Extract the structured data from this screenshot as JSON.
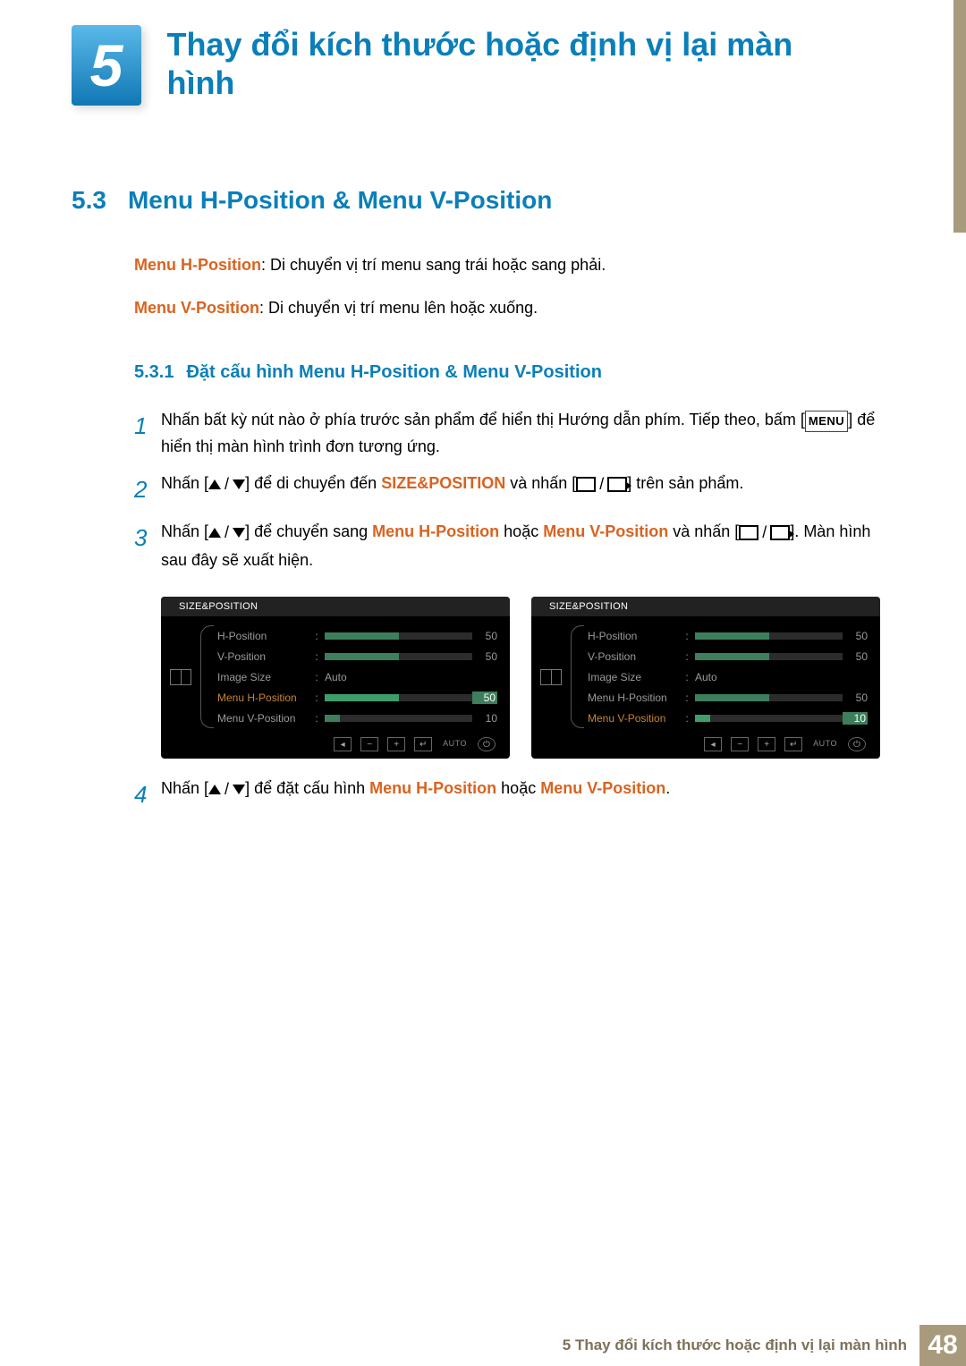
{
  "chapter": {
    "number": "5",
    "title": "Thay đổi kích thước hoặc định vị lại màn hình"
  },
  "section": {
    "number": "5.3",
    "title": "Menu H-Position & Menu V-Position"
  },
  "defs": {
    "h": {
      "term": "Menu H-Position",
      "text": ": Di chuyển vị trí menu sang trái hoặc sang phải."
    },
    "v": {
      "term": "Menu V-Position",
      "text": ": Di chuyển vị trí menu lên hoặc xuống."
    }
  },
  "subsection": {
    "number": "5.3.1",
    "title": "Đặt cấu hình Menu H-Position & Menu V-Position"
  },
  "steps": {
    "s1": {
      "n": "1",
      "a": "Nhấn bất kỳ nút nào ở phía trước sản phẩm để hiển thị Hướng dẫn phím. Tiếp theo, bấm [",
      "menu": "MENU",
      "b": "] để hiển thị màn hình trình đơn tương ứng."
    },
    "s2": {
      "n": "2",
      "a": "Nhấn [",
      "b": "] để di chuyển đến ",
      "hl": "SIZE&POSITION",
      "c": " và nhấn [",
      "d": "] trên sản phẩm."
    },
    "s3": {
      "n": "3",
      "a": "Nhấn [",
      "b": "] để chuyển sang ",
      "hl1": "Menu H-Position",
      "c": " hoặc ",
      "hl2": "Menu V-Position",
      "d": " và nhấn [",
      "e": "]. Màn hình sau đây sẽ xuất hiện."
    },
    "s4": {
      "n": "4",
      "a": "Nhấn [",
      "b": "] để đặt cấu hình ",
      "hl1": "Menu H-Position",
      "c": " hoặc ",
      "hl2": "Menu V-Position",
      "d": "."
    }
  },
  "osd": {
    "title": "SIZE&POSITION",
    "items": {
      "hp": {
        "label": "H-Position",
        "val": "50"
      },
      "vp": {
        "label": "V-Position",
        "val": "50"
      },
      "is": {
        "label": "Image Size",
        "val": "Auto"
      },
      "mhp": {
        "label": "Menu H-Position",
        "val": "50"
      },
      "mvp": {
        "label": "Menu V-Position",
        "val": "10"
      }
    },
    "auto": "AUTO"
  },
  "footer": {
    "text": "5 Thay đổi kích thước hoặc định vị lại màn hình",
    "page": "48"
  }
}
